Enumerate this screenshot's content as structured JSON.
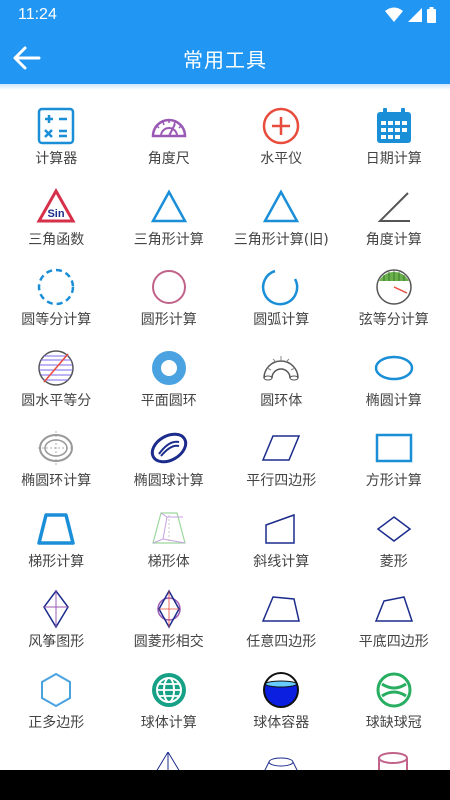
{
  "status_bar": {
    "time": "11:24",
    "icons": [
      "wifi-icon",
      "signal-icon",
      "battery-icon"
    ]
  },
  "app_bar": {
    "title": "常用工具",
    "back_icon": "arrow-left-icon"
  },
  "colors": {
    "primary": "#2196f3",
    "icon_blue": "#1a8fd8",
    "icon_purple": "#9b59b6",
    "icon_red": "#e74c3c",
    "icon_navy": "#1c2c8c",
    "icon_teal": "#16a085",
    "icon_pink": "#c0628a"
  },
  "tools": [
    {
      "label": "计算器",
      "icon": "calculator-icon"
    },
    {
      "label": "角度尺",
      "icon": "protractor-icon"
    },
    {
      "label": "水平仪",
      "icon": "level-icon"
    },
    {
      "label": "日期计算",
      "icon": "calendar-icon"
    },
    {
      "label": "三角函数",
      "icon": "sin-triangle-icon"
    },
    {
      "label": "三角形计算",
      "icon": "triangle-icon"
    },
    {
      "label": "三角形计算(旧)",
      "icon": "triangle-old-icon"
    },
    {
      "label": "角度计算",
      "icon": "angle-icon"
    },
    {
      "label": "圆等分计算",
      "icon": "dashed-circle-icon"
    },
    {
      "label": "圆形计算",
      "icon": "circle-icon"
    },
    {
      "label": "圆弧计算",
      "icon": "arc-icon"
    },
    {
      "label": "弦等分计算",
      "icon": "chord-icon"
    },
    {
      "label": "圆水平等分",
      "icon": "circle-horizontal-icon"
    },
    {
      "label": "平面圆环",
      "icon": "ring-icon"
    },
    {
      "label": "圆环体",
      "icon": "torus-icon"
    },
    {
      "label": "椭圆计算",
      "icon": "ellipse-icon"
    },
    {
      "label": "椭圆环计算",
      "icon": "ellipse-ring-icon"
    },
    {
      "label": "椭圆球计算",
      "icon": "ellipsoid-icon"
    },
    {
      "label": "平行四边形",
      "icon": "parallelogram-icon"
    },
    {
      "label": "方形计算",
      "icon": "rectangle-icon"
    },
    {
      "label": "梯形计算",
      "icon": "trapezoid-icon"
    },
    {
      "label": "梯形体",
      "icon": "frustum-icon"
    },
    {
      "label": "斜线计算",
      "icon": "slant-icon"
    },
    {
      "label": "菱形",
      "icon": "rhombus-icon"
    },
    {
      "label": "风筝图形",
      "icon": "kite-icon"
    },
    {
      "label": "圆菱形相交",
      "icon": "circle-rhombus-icon"
    },
    {
      "label": "任意四边形",
      "icon": "quadrilateral-icon"
    },
    {
      "label": "平底四边形",
      "icon": "flat-quadrilateral-icon"
    },
    {
      "label": "正多边形",
      "icon": "hexagon-icon"
    },
    {
      "label": "球体计算",
      "icon": "globe-icon"
    },
    {
      "label": "球体容器",
      "icon": "sphere-container-icon"
    },
    {
      "label": "球缺球冠",
      "icon": "sphere-cap-icon"
    }
  ]
}
